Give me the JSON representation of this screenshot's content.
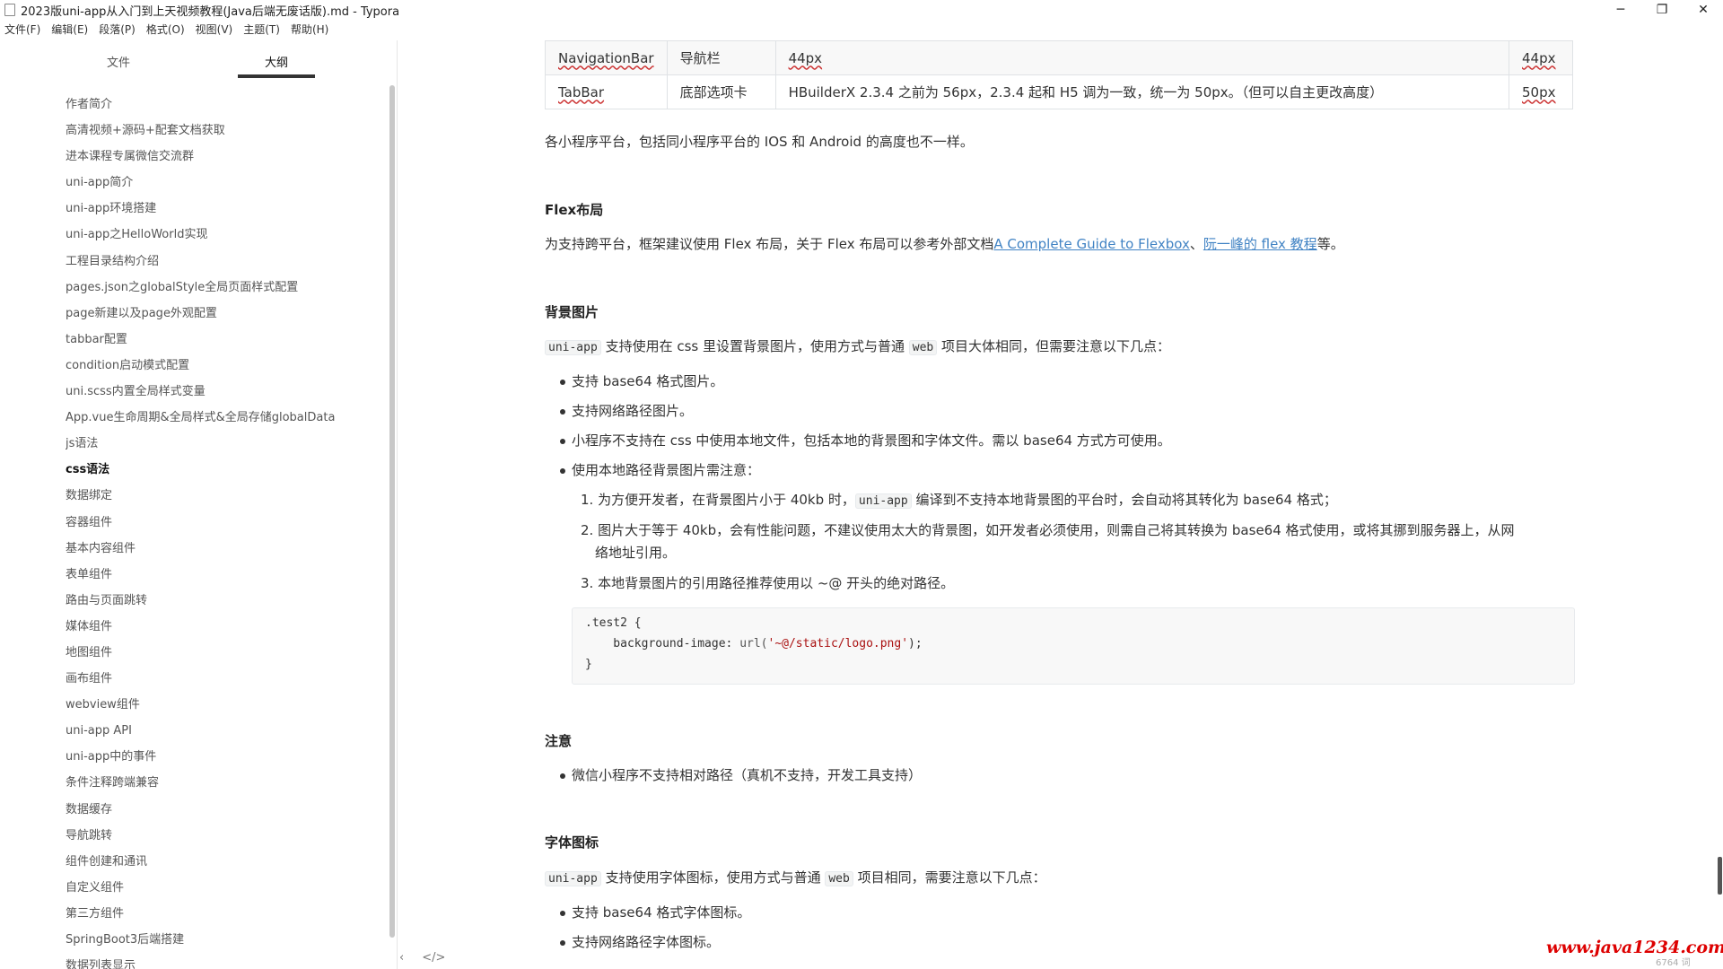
{
  "window": {
    "title": "2023版uni-app从入门到上天视频教程(Java后端无废话版).md - Typora",
    "controls": {
      "minimize": "─",
      "maximize": "❐",
      "close": "✕"
    }
  },
  "menu": [
    "文件(F)",
    "编辑(E)",
    "段落(P)",
    "格式(O)",
    "视图(V)",
    "主题(T)",
    "帮助(H)"
  ],
  "sidebar": {
    "tabs": {
      "files": "文件",
      "outline": "大纲"
    },
    "outline": [
      "作者简介",
      "高清视频+源码+配套文档获取",
      "进本课程专属微信交流群",
      "uni-app简介",
      "uni-app环境搭建",
      "uni-app之HelloWorld实现",
      "工程目录结构介绍",
      "pages.json之globalStyle全局页面样式配置",
      "page新建以及page外观配置",
      "tabbar配置",
      "condition启动模式配置",
      "uni.scss内置全局样式变量",
      "App.vue生命周期&全局样式&全局存储globalData",
      "js语法",
      "css语法",
      "数据绑定",
      "容器组件",
      "基本内容组件",
      "表单组件",
      "路由与页面跳转",
      "媒体组件",
      "地图组件",
      "画布组件",
      "webview组件",
      "uni-app API",
      "uni-app中的事件",
      "条件注释跨端兼容",
      "数据缓存",
      "导航跳转",
      "组件创建和通讯",
      "自定义组件",
      "第三方组件",
      "SpringBoot3后端搭建",
      "数据列表显示"
    ],
    "active_index": 14,
    "bottom": {
      "back": "‹",
      "source": "</>"
    }
  },
  "doc": {
    "table": [
      [
        "NavigationBar",
        "导航栏",
        "44px",
        "44px"
      ],
      [
        "TabBar",
        "底部选项卡",
        "HBuilderX 2.3.4 之前为 56px，2.3.4 起和 H5 调为一致，统一为 50px。（但可以自主更改高度）",
        "50px"
      ]
    ],
    "para_platform": "各小程序平台，包括同小程序平台的 IOS 和 Android 的高度也不一样。",
    "h_flex": "Flex布局",
    "flex_text": "为支持跨平台，框架建议使用 Flex 布局，关于 Flex 布局可以参考外部文档",
    "flex_link1": "A Complete Guide to Flexbox",
    "flex_sep": "、",
    "flex_link2": "阮一峰的 flex 教程",
    "flex_end": "等。",
    "h_bg": "背景图片",
    "bg_intro": {
      "code1": "uni-app",
      "t1": " 支持使用在 css 里设置背景图片，使用方式与普通 ",
      "code2": "web",
      "t2": " 项目大体相同，但需要注意以下几点："
    },
    "bg_list": [
      "支持 base64 格式图片。",
      "支持网络路径图片。",
      "小程序不支持在 css 中使用本地文件，包括本地的背景图和字体文件。需以 base64 方式方可使用。",
      "使用本地路径背景图片需注意："
    ],
    "bg_ol": [
      {
        "a": "1. 为方便开发者，在背景图片小于 40kb 时，",
        "code": "uni-app",
        "b": " 编译到不支持本地背景图的平台时，会自动将其转化为 base64 格式；"
      },
      {
        "a": "2. 图片大于等于 40kb，会有性能问题，不建议使用太大的背景图，如开发者必须使用，则需自己将其转换为 base64 格式使用，或将其挪到服务器上，从网",
        "b": "络地址引用。"
      },
      {
        "a": "3. 本地背景图片的引用路径推荐使用以 ~@ 开头的绝对路径。"
      }
    ],
    "code": {
      "l1": ".test2 {",
      "l2a": "    background-image: ",
      "l2b": "url(",
      "l2c": "'~@/static/logo.png'",
      "l2d": ");",
      "l3": "}"
    },
    "h_note": "注意",
    "note_list": [
      "微信小程序不支持相对路径（真机不支持，开发工具支持）"
    ],
    "h_font": "字体图标",
    "font_intro": {
      "code1": "uni-app",
      "t1": " 支持使用字体图标，使用方式与普通 ",
      "code2": "web",
      "t2": " 项目相同，需要注意以下几点："
    },
    "font_list": [
      "支持 base64 格式字体图标。",
      "支持网络路径字体图标。"
    ]
  },
  "watermark": "www.java1234.com",
  "wordcount": "6764 词"
}
